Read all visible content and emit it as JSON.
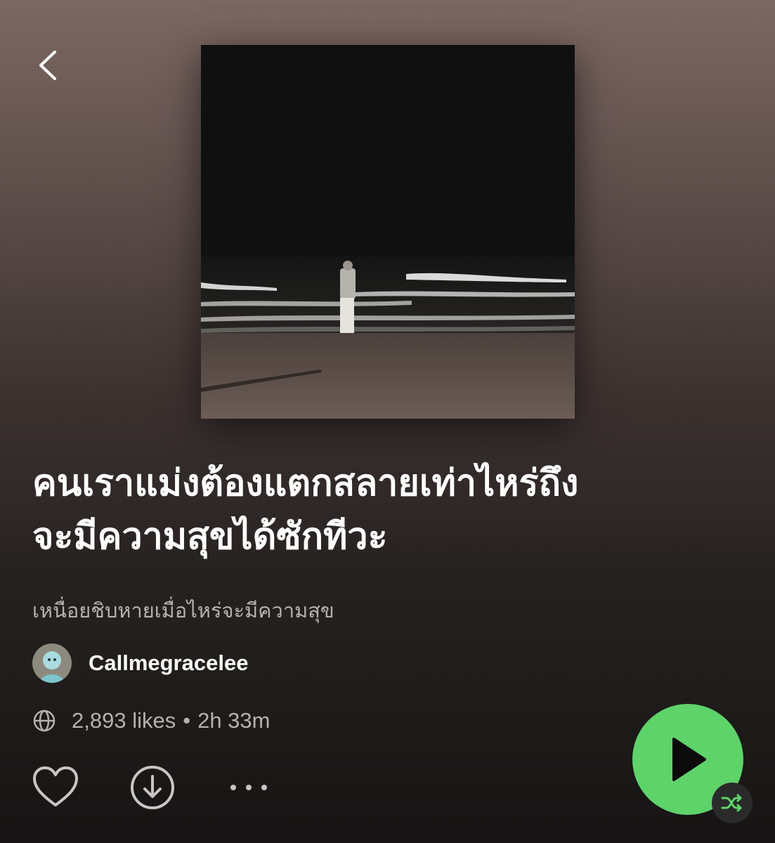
{
  "playlist": {
    "title": "คนเราแม่งต้องแตกสลายเท่าไหร่ถึง\nจะมีความสุขได้ซักทีวะ",
    "description": "เหนื่อยชิบหายเมื่อไหร่จะมีความสุข",
    "owner": "Callmegracelee",
    "likes": "2,893 likes",
    "separator": "•",
    "duration": "2h 33m"
  },
  "icons": {
    "back": "chevron-left-icon",
    "visibility": "globe-icon",
    "like": "heart-outline-icon",
    "download": "download-circle-icon",
    "more": "more-horizontal-icon",
    "play": "play-icon",
    "shuffle": "shuffle-icon"
  },
  "colors": {
    "accent": "#5ed36a",
    "shuffle_badge": "#2a2a2a",
    "shuffle_icon": "#5ed36a",
    "muted_text": "#b7b1ae"
  }
}
